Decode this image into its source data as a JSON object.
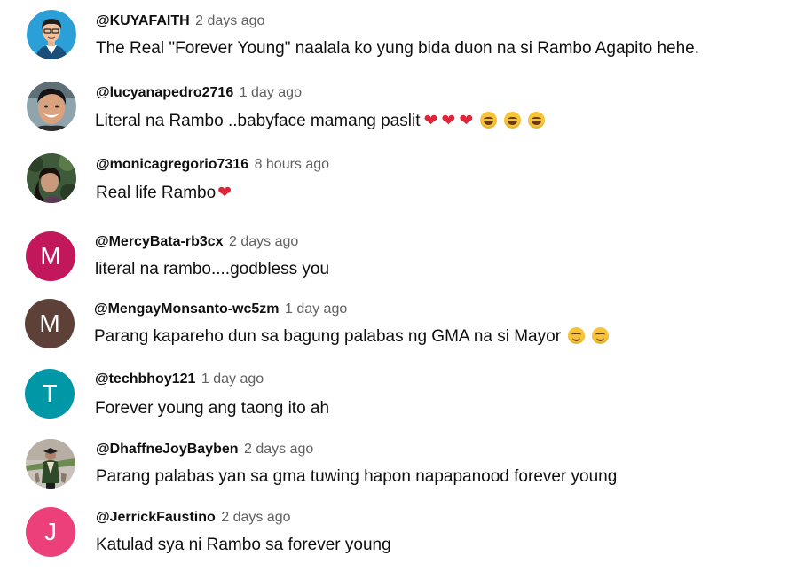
{
  "comments": [
    {
      "handle": "@KUYAFAITH",
      "time": "2 days ago",
      "text": "The Real \"Forever Young\" naalala ko yung bida duon na si Rambo Agapito hehe.",
      "avatar": {
        "type": "illustrated-man",
        "bg": "#2a9fd8"
      }
    },
    {
      "handle": "@lucyanapedro2716",
      "time": "1 day ago",
      "text": "Literal na Rambo ..babyface mamang paslit",
      "emojis": [
        "red-heart",
        "red-heart",
        "red-heart",
        "tears-of-joy",
        "tears-of-joy",
        "tears-of-joy"
      ],
      "avatar": {
        "type": "photo-smiling-boy",
        "bg": "#8fa4ad"
      }
    },
    {
      "handle": "@monicagregorio7316",
      "time": "8 hours ago",
      "text": "Real life Rambo",
      "emojis": [
        "red-heart"
      ],
      "avatar": {
        "type": "photo-girl-foliage",
        "bg": "#3f5a3a"
      }
    },
    {
      "handle": "@MercyBata-rb3cx",
      "time": "2 days ago",
      "text": "literal na rambo....godbless you",
      "avatar": {
        "type": "letter",
        "letter": "M",
        "bg": "#c2185b"
      }
    },
    {
      "handle": "@MengayMonsanto-wc5zm",
      "time": "1 day ago",
      "text": "Parang kapareho dun sa bagung palabas ng GMA na si Mayor",
      "emojis": [
        "smiling-face",
        "smiling-face"
      ],
      "avatar": {
        "type": "letter",
        "letter": "M",
        "bg": "#5d4037"
      }
    },
    {
      "handle": "@techbhoy121",
      "time": "1 day ago",
      "text": "Forever young ang taong ito ah",
      "avatar": {
        "type": "letter",
        "letter": "T",
        "bg": "#0097a7"
      }
    },
    {
      "handle": "@DhaffneJoyBayben",
      "time": "2 days ago",
      "text": "Parang palabas yan sa gma tuwing hapon napapanood forever young",
      "avatar": {
        "type": "photo-graduate",
        "bg": "#c9c2ba"
      }
    },
    {
      "handle": "@JerrickFaustino",
      "time": "2 days ago",
      "text": "Katulad sya ni Rambo sa forever young",
      "avatar": {
        "type": "letter",
        "letter": "J",
        "bg": "#ec407a"
      }
    }
  ],
  "colors": {
    "handle": "#0f0f0f",
    "timestamp": "#606060",
    "heart": "#e0243a",
    "emoji_face": "#f7c339"
  }
}
